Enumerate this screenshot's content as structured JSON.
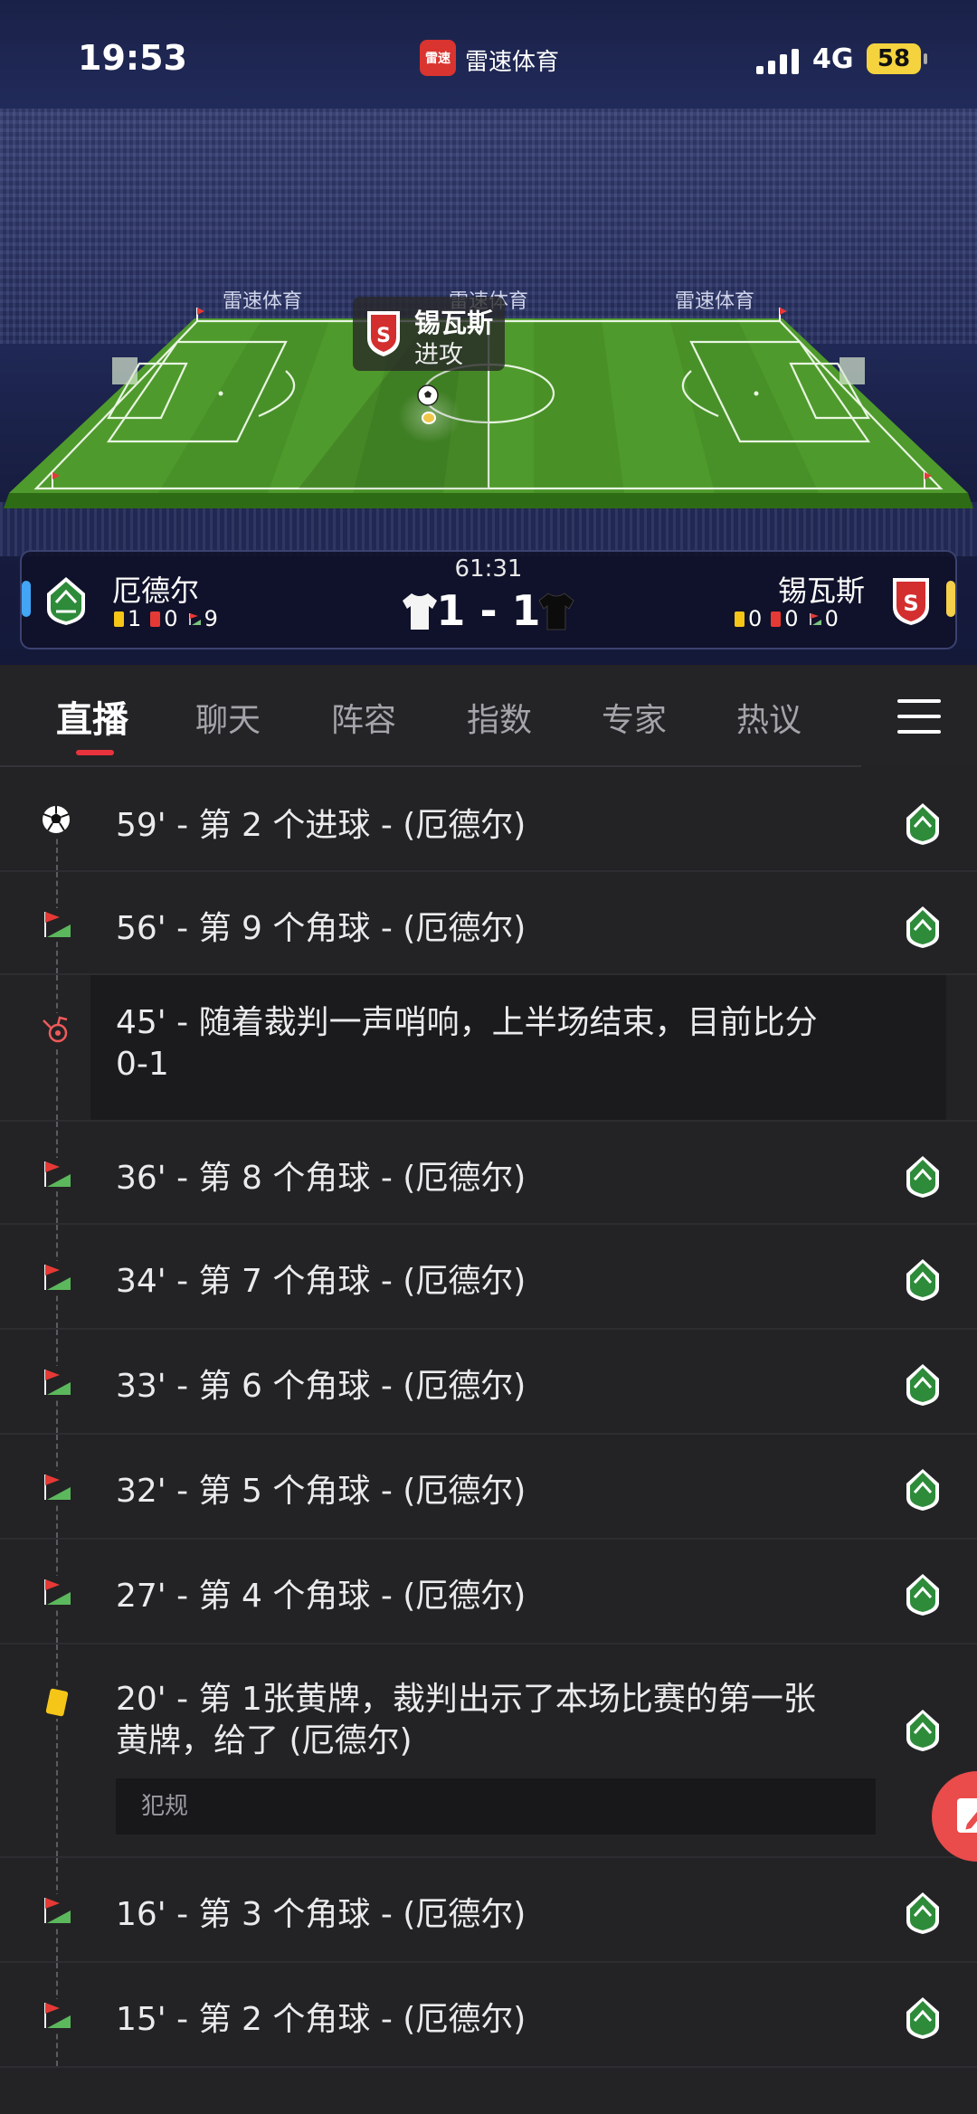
{
  "status_bar": {
    "time": "19:53",
    "app_badge": "雷速",
    "app_name": "雷速体育",
    "network": "4G",
    "battery": "58"
  },
  "pitch": {
    "sponsor_text": "雷速体育",
    "possession_team": "锡瓦斯",
    "possession_action": "进攻"
  },
  "match": {
    "time": "61:31",
    "score": "1 - 1",
    "home": {
      "name": "厄德尔",
      "yellow": "1",
      "red": "0",
      "corners": "9"
    },
    "away": {
      "name": "锡瓦斯",
      "yellow": "0",
      "red": "0",
      "corners": "0"
    }
  },
  "tabs": [
    "直播",
    "聊天",
    "阵容",
    "指数",
    "专家",
    "热议"
  ],
  "events": [
    {
      "text": "59' - 第 2 个进球 - (厄德尔)",
      "icon": "soccer-ball-icon"
    },
    {
      "text": "56' - 第 9 个角球 - (厄德尔)",
      "icon": "corner-flag-icon"
    },
    {
      "text": "45' - 随着裁判一声哨响，上半场结束，目前比分",
      "text2": "0-1",
      "icon": "whistle-icon"
    },
    {
      "text": "36' - 第 8 个角球 - (厄德尔)",
      "icon": "corner-flag-icon"
    },
    {
      "text": "34' - 第 7 个角球 - (厄德尔)",
      "icon": "corner-flag-icon"
    },
    {
      "text": "33' - 第 6 个角球 - (厄德尔)",
      "icon": "corner-flag-icon"
    },
    {
      "text": "32' - 第 5 个角球 - (厄德尔)",
      "icon": "corner-flag-icon"
    },
    {
      "text": "27' - 第 4 个角球 - (厄德尔)",
      "icon": "corner-flag-icon"
    },
    {
      "text": "20' - 第 1张黄牌，裁判出示了本场比赛的第一张",
      "text2": "黄牌，给了 (厄德尔)",
      "note": "犯规",
      "icon": "yellow-card-icon"
    },
    {
      "text": "16' - 第 3 个角球 - (厄德尔)",
      "icon": "corner-flag-icon"
    },
    {
      "text": "15' - 第 2 个角球 - (厄德尔)",
      "icon": "corner-flag-icon"
    }
  ],
  "colors": {
    "accent": "#e8333d",
    "background": "#232325",
    "pitch": "#4f9a2c",
    "home_crest": "#2e8b3a",
    "away_crest": "#d32f2f"
  }
}
